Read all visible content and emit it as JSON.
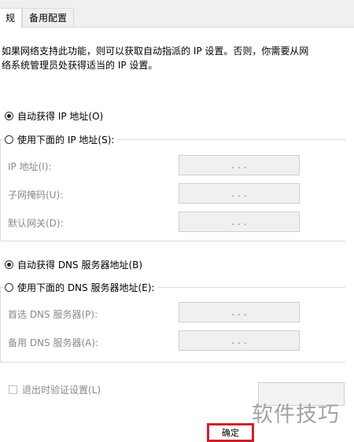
{
  "tabs": {
    "general": "规",
    "alternate": "备用配置"
  },
  "description": {
    "line1": "如果网络支持此功能，则可以获取自动指派的 IP 设置。否则，你需要从网",
    "line2": "络系统管理员处获得适当的 IP 设置。"
  },
  "ip": {
    "auto_label": "自动获得 IP 地址(O)",
    "manual_label": "使用下面的 IP 地址(S):",
    "fields": [
      {
        "label": "IP 地址(I):",
        "value": ".   .   ."
      },
      {
        "label": "子网掩码(U):",
        "value": ".   .   ."
      },
      {
        "label": "默认网关(D):",
        "value": ".   .   ."
      }
    ]
  },
  "dns": {
    "auto_label": "自动获得 DNS 服务器地址(B)",
    "manual_label": "使用下面的 DNS 服务器地址(E):",
    "fields": [
      {
        "label": "首选 DNS 服务器(P):",
        "value": ".   .   ."
      },
      {
        "label": "备用 DNS 服务器(A):",
        "value": ".   .   ."
      }
    ]
  },
  "validate_label": "退出时验证设置(L)",
  "ok_label": "确定",
  "watermark": "软件技巧"
}
